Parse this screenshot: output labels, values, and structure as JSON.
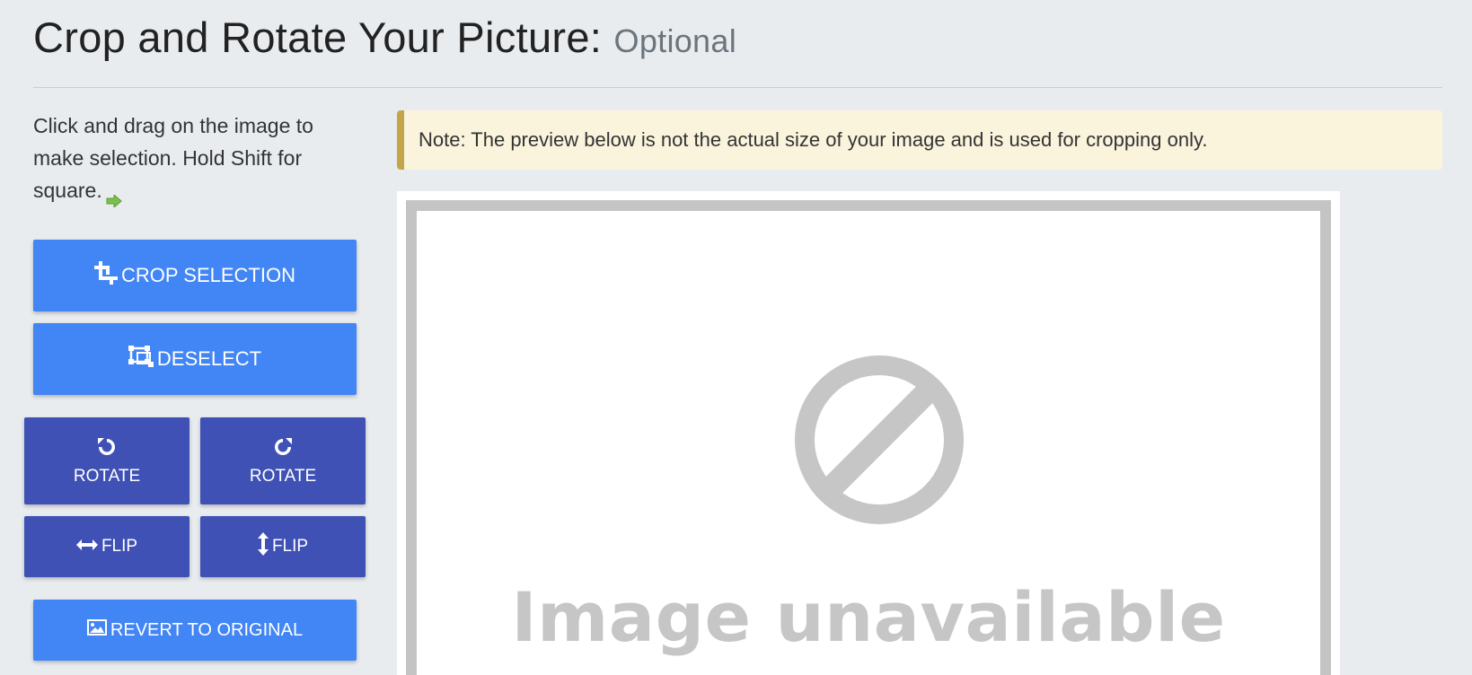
{
  "header": {
    "title": "Crop and Rotate Your Picture:",
    "subtitle": "Optional"
  },
  "instructions": {
    "text": "Click and drag on the image to make selection. Hold Shift for square.",
    "icon": "arrow-right-icon"
  },
  "buttons": {
    "crop_selection": "CROP SELECTION",
    "deselect": "DESELECT",
    "rotate_left": "ROTATE",
    "rotate_right": "ROTATE",
    "flip_horizontal": "FLIP",
    "flip_vertical": "FLIP",
    "revert": "REVERT TO ORIGINAL"
  },
  "note": {
    "text": "Note: The preview below is not the actual size of your image and is used for cropping only."
  },
  "preview": {
    "placeholder_text": "Image unavailable",
    "icon": "prohibited-icon"
  },
  "colors": {
    "primary_button": "#4285f4",
    "secondary_button": "#3f51b5",
    "note_background": "#fbf4dd",
    "note_border": "#c5a54a",
    "page_background": "#e9ecef"
  }
}
